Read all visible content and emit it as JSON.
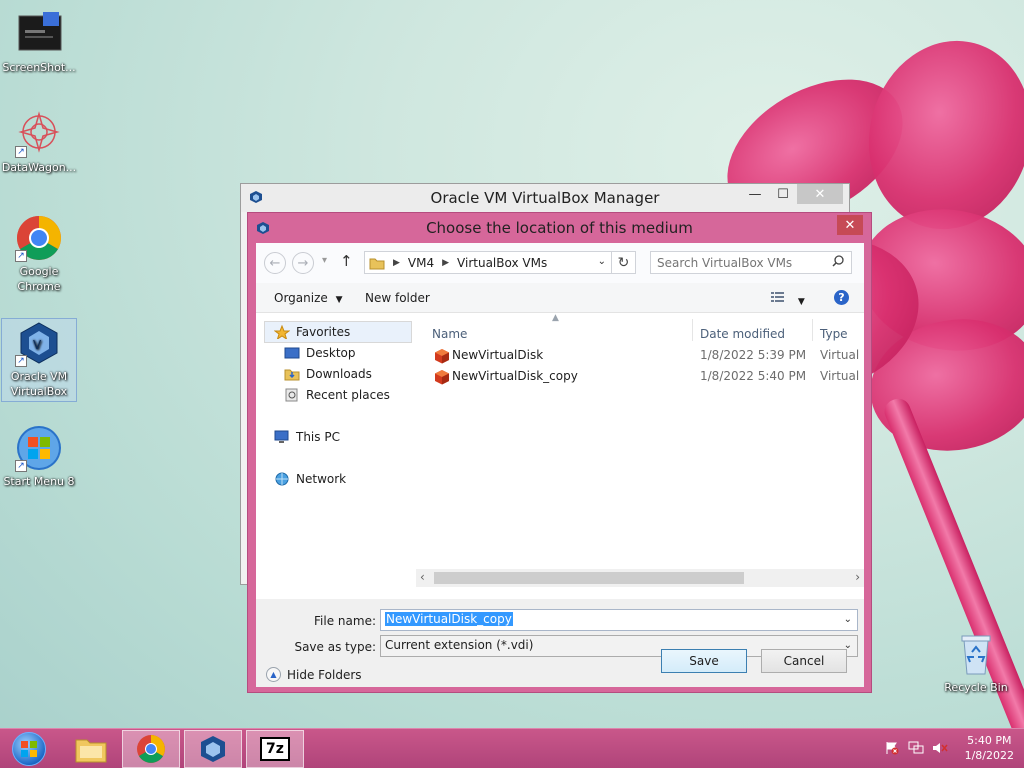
{
  "desktop": {
    "icons": [
      {
        "label": "ScreenShot..."
      },
      {
        "label": "DataWagon..."
      },
      {
        "label": "Google Chrome"
      },
      {
        "label": "Oracle VM VirtualBox"
      },
      {
        "label": "Start Menu 8"
      },
      {
        "label": "Recycle Bin"
      }
    ]
  },
  "back_window": {
    "title": "Oracle VM VirtualBox Manager"
  },
  "dialog": {
    "title": "Choose the location of this medium",
    "address": {
      "crumbs": [
        "VM4",
        "VirtualBox VMs"
      ]
    },
    "search_placeholder": "Search VirtualBox VMs",
    "toolbar": {
      "organize": "Organize",
      "new_folder": "New folder"
    },
    "nav": {
      "favorites": "Favorites",
      "desktop": "Desktop",
      "downloads": "Downloads",
      "recent": "Recent places",
      "this_pc": "This PC",
      "network": "Network"
    },
    "columns": {
      "name": "Name",
      "date": "Date modified",
      "type": "Type"
    },
    "files": [
      {
        "name": "NewVirtualDisk",
        "date": "1/8/2022 5:39 PM",
        "type": "Virtual Dis"
      },
      {
        "name": "NewVirtualDisk_copy",
        "date": "1/8/2022 5:40 PM",
        "type": "Virtual Dis"
      }
    ],
    "file_name_label": "File name:",
    "file_name_value": "NewVirtualDisk_copy",
    "save_type_label": "Save as type:",
    "save_type_value": "Current extension (*.vdi)",
    "hide_folders": "Hide Folders",
    "save": "Save",
    "cancel": "Cancel"
  },
  "taskbar": {
    "clock_time": "5:40 PM",
    "clock_date": "1/8/2022",
    "sevenzip_label": "7z"
  }
}
